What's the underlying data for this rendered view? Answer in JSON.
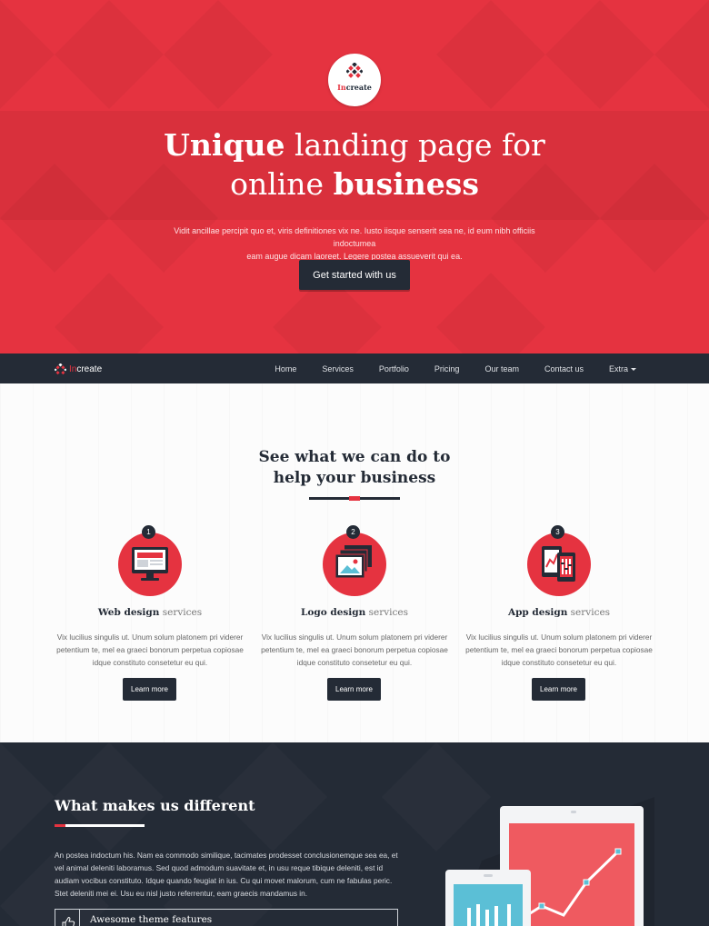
{
  "hero": {
    "logo": {
      "accent": "In",
      "rest": "create"
    },
    "title": {
      "bold1": "Unique",
      "rest1": " landing page for",
      "rest2": "online ",
      "bold2": "business"
    },
    "subtitle_line1": "Vidit ancillae percipit quo et, viris definitiones vix ne. Iusto iisque senserit sea ne, id eum nibh officiis indoctumea",
    "subtitle_line2": "eam augue dicam laoreet. Legere postea assueverit qui ea.",
    "cta_label": "Get started with us"
  },
  "nav": {
    "brand": {
      "accent": "In",
      "rest": "create"
    },
    "items": [
      {
        "label": "Home"
      },
      {
        "label": "Services"
      },
      {
        "label": "Portfolio"
      },
      {
        "label": "Pricing"
      },
      {
        "label": "Our team"
      },
      {
        "label": "Contact us"
      },
      {
        "label": "Extra"
      }
    ]
  },
  "services": {
    "title": {
      "bold1": "See what",
      "rest1": " we can do to",
      "rest2": "help your ",
      "bold2": "business"
    },
    "items": [
      {
        "number": "1",
        "name_bold": "Web design",
        "name_rest": " services",
        "icon": "monitor-icon",
        "desc": "Vix lucilius singulis ut. Unum solum platonem pri viderer petentium te, mel ea graeci bonorum perpetua copiosae idque constituto consetetur eu qui.",
        "button": "Learn more"
      },
      {
        "number": "2",
        "name_bold": "Logo design",
        "name_rest": " services",
        "icon": "image-stack-icon",
        "desc": "Vix lucilius singulis ut. Unum solum platonem pri viderer petentium te, mel ea graeci bonorum perpetua copiosae idque constituto consetetur eu qui.",
        "button": "Learn more"
      },
      {
        "number": "3",
        "name_bold": "App design",
        "name_rest": " services",
        "icon": "mobile-devices-icon",
        "desc": "Vix lucilius singulis ut. Unum solum platonem pri viderer petentium te, mel ea graeci bonorum perpetua copiosae idque constituto consetetur eu qui.",
        "button": "Learn more"
      }
    ]
  },
  "different": {
    "title_bold": "What makes",
    "title_rest": " us different",
    "text": "An postea indoctum his. Nam ea commodo similique, tacimates prodesset conclusionemque sea ea, et vel animal deleniti laboramus. Sed quod admodum suavitate et, in usu reque tibique deleniti, est id audiam vocibus constituto. Idque quando feugiat in ius. Cu qui movet malorum, cum ne fabulas peric. Stet deleniti mei ei. Usu eu nisl justo referrentur, eam graecis mandamus in.",
    "feature_label": "Awesome theme features",
    "feature_icon": "thumbs-up-icon"
  },
  "colors": {
    "accent": "#e53340",
    "dark": "#242b36"
  }
}
